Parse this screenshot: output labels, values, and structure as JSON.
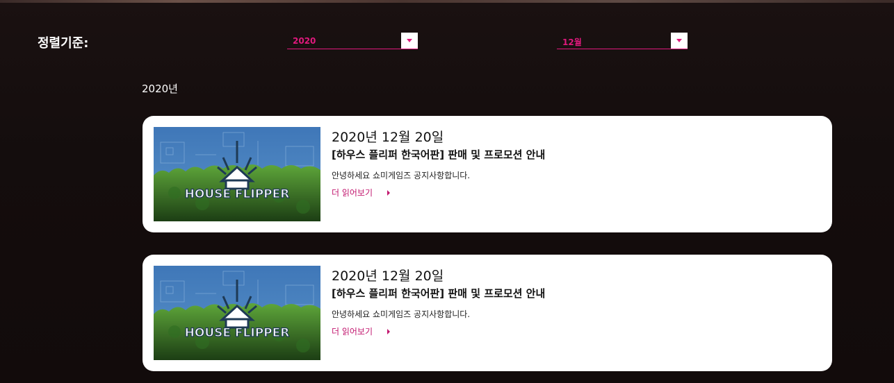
{
  "filter": {
    "sort_label": "정렬기준:",
    "year_value": "2020",
    "month_value": "12월"
  },
  "year_heading": "2020년",
  "posts": [
    {
      "date": "2020년 12월 20일",
      "title": "[하우스 플리퍼 한국어판] 판매 및 프로모션 안내",
      "excerpt": "안녕하세요 쇼미게임즈 공지사항합니다.",
      "read_more": "더 읽어보기",
      "thumbnail_text": "HOUSE FLIPPER"
    },
    {
      "date": "2020년 12월 20일",
      "title": "[하우스 플리퍼 한국어판] 판매 및 프로모션 안내",
      "excerpt": "안녕하세요 쇼미게임즈 공지사항합니다.",
      "read_more": "더 읽어보기",
      "thumbnail_text": "HOUSE FLIPPER"
    }
  ],
  "colors": {
    "accent": "#e0197d",
    "background": "#130c0c",
    "card": "#ffffff"
  },
  "icons": {
    "dropdown": "caret-down-icon",
    "read_more": "caret-right-icon"
  }
}
